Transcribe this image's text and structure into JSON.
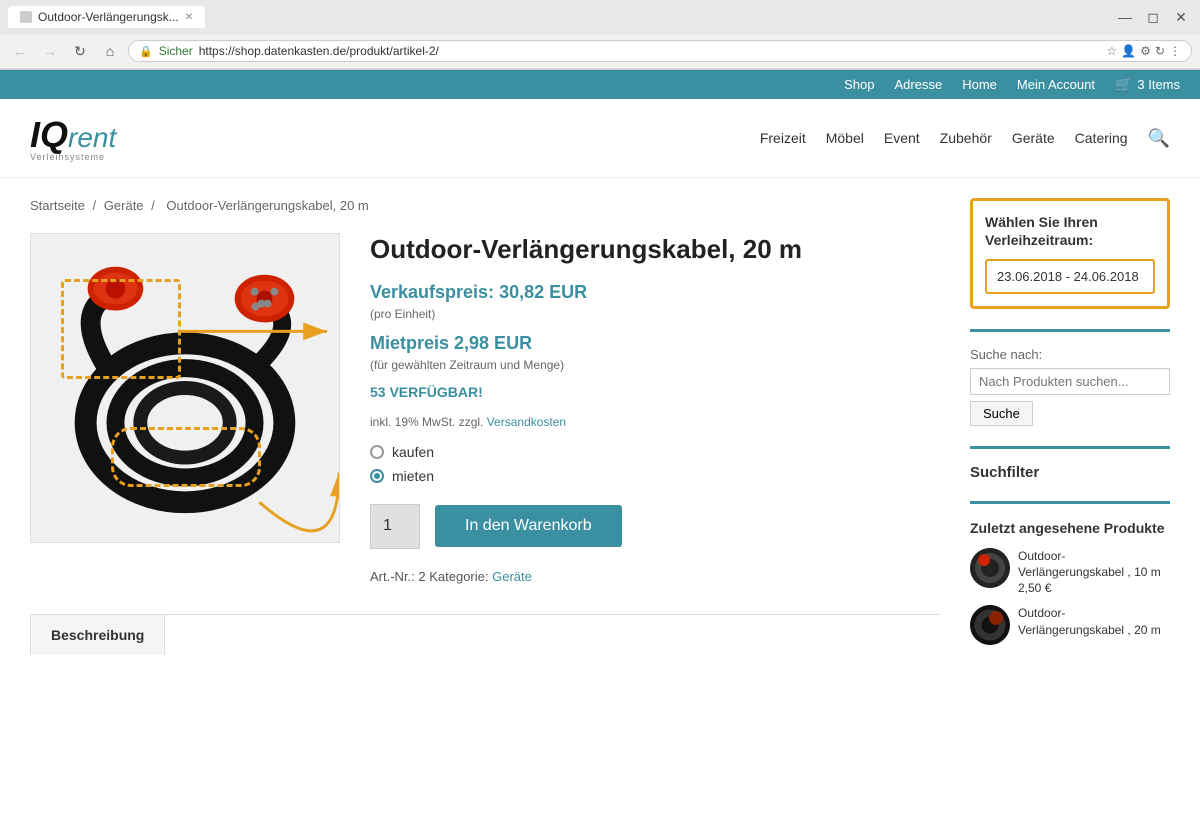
{
  "browser": {
    "tab_title": "Outdoor-Verlängerungsk...",
    "address": "https://shop.datenkasten.de/produkt/artikel-2/",
    "secure_text": "Sicher"
  },
  "top_bar": {
    "shop": "Shop",
    "adresse": "Adresse",
    "home": "Home",
    "mein_account": "Mein Account",
    "cart_icon": "🛒",
    "cart_items": "3 Items"
  },
  "nav": {
    "logo_iq": "IQ",
    "logo_rent": "rent",
    "logo_tagline": "Verleihsysteme",
    "freizeit": "Freizeit",
    "mobel": "Möbel",
    "event": "Event",
    "zubehor": "Zubehör",
    "gerate": "Geräte",
    "catering": "Catering"
  },
  "breadcrumb": {
    "startseite": "Startseite",
    "sep1": "/",
    "gerate": "Geräte",
    "sep2": "/",
    "current": "Outdoor-Verlängerungskabel, 20 m"
  },
  "product": {
    "title": "Outdoor-Verlängerungskabel, 20 m",
    "verkaufspreis_label": "Verkaufspreis: 30,82 EUR",
    "pro_einheit": "(pro Einheit)",
    "mietpreis_label": "Mietpreis 2,98 EUR",
    "miet_note": "(für gewählten Zeitraum und Menge)",
    "verfugbar": "53 VERFÜGBAR!",
    "mwst": "inkl. 19% MwSt. zzgl.",
    "versandkosten": "Versandkosten",
    "kaufen": "kaufen",
    "mieten": "mieten",
    "qty": "1",
    "add_to_cart": "In den Warenkorb",
    "art_nr_label": "Art.-Nr.: 2 Kategorie:",
    "art_nr_link": "Geräte",
    "beschreibung_tab": "Beschreibung"
  },
  "sidebar": {
    "verleihe_title": "Wählen Sie Ihren Verleihzeitraum:",
    "date_range": "23.06.2018 - 24.06.2018",
    "suche_label": "Suche nach:",
    "suche_placeholder": "Nach Produkten suchen...",
    "suche_btn": "Suche",
    "suchfilter": "Suchfilter",
    "zuletzt_title": "Zuletzt angesehene Produkte",
    "recent1_name": "Outdoor-Verlängerungskabel , 10 m",
    "recent1_price": "2,50 €",
    "recent2_name": "Outdoor-Verlängerungskabel , 20 m",
    "recent2_price": ""
  },
  "colors": {
    "teal": "#3a8fa0",
    "orange": "#e8a020"
  }
}
